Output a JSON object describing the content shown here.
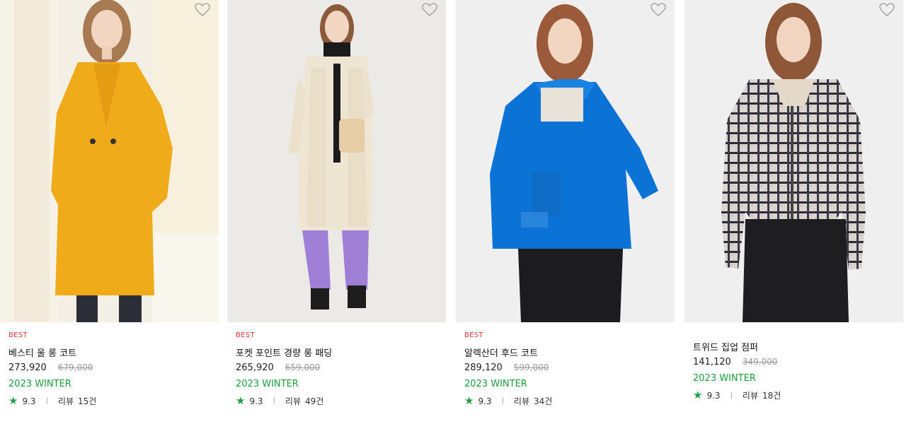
{
  "products": [
    {
      "badge": "BEST",
      "name": "베스티 울 롱 코트",
      "price": "273,920",
      "original_price": "679,000",
      "season": "2023 WINTER",
      "rating": "9.3",
      "review_label": "리뷰",
      "review_count": "15건",
      "image": "model-yellow-wool-long-coat"
    },
    {
      "badge": "BEST",
      "name": "포켓 포인트 경량 롱 패딩",
      "price": "265,920",
      "original_price": "659,000",
      "season": "2023 WINTER",
      "rating": "9.3",
      "review_label": "리뷰",
      "review_count": "49건",
      "image": "model-beige-quilted-long-padding"
    },
    {
      "badge": "BEST",
      "name": "알렉산더 후드 코트",
      "price": "289,120",
      "original_price": "599,000",
      "season": "2023 WINTER",
      "rating": "9.3",
      "review_label": "리뷰",
      "review_count": "34건",
      "image": "model-blue-hooded-coat"
    },
    {
      "badge": "",
      "name": "트위드 집업 점퍼",
      "price": "141,120",
      "original_price": "349,000",
      "season": "2023 WINTER",
      "rating": "9.3",
      "review_label": "리뷰",
      "review_count": "18건",
      "image": "model-tweed-zip-jumper"
    }
  ],
  "colors": {
    "badge": "#e23b3b",
    "season": "#1e9c3f",
    "star": "#1e9c3f",
    "original_price": "#9a9a9a"
  },
  "icons": {
    "wishlist": "heart-outline-icon",
    "rating": "star-icon"
  }
}
